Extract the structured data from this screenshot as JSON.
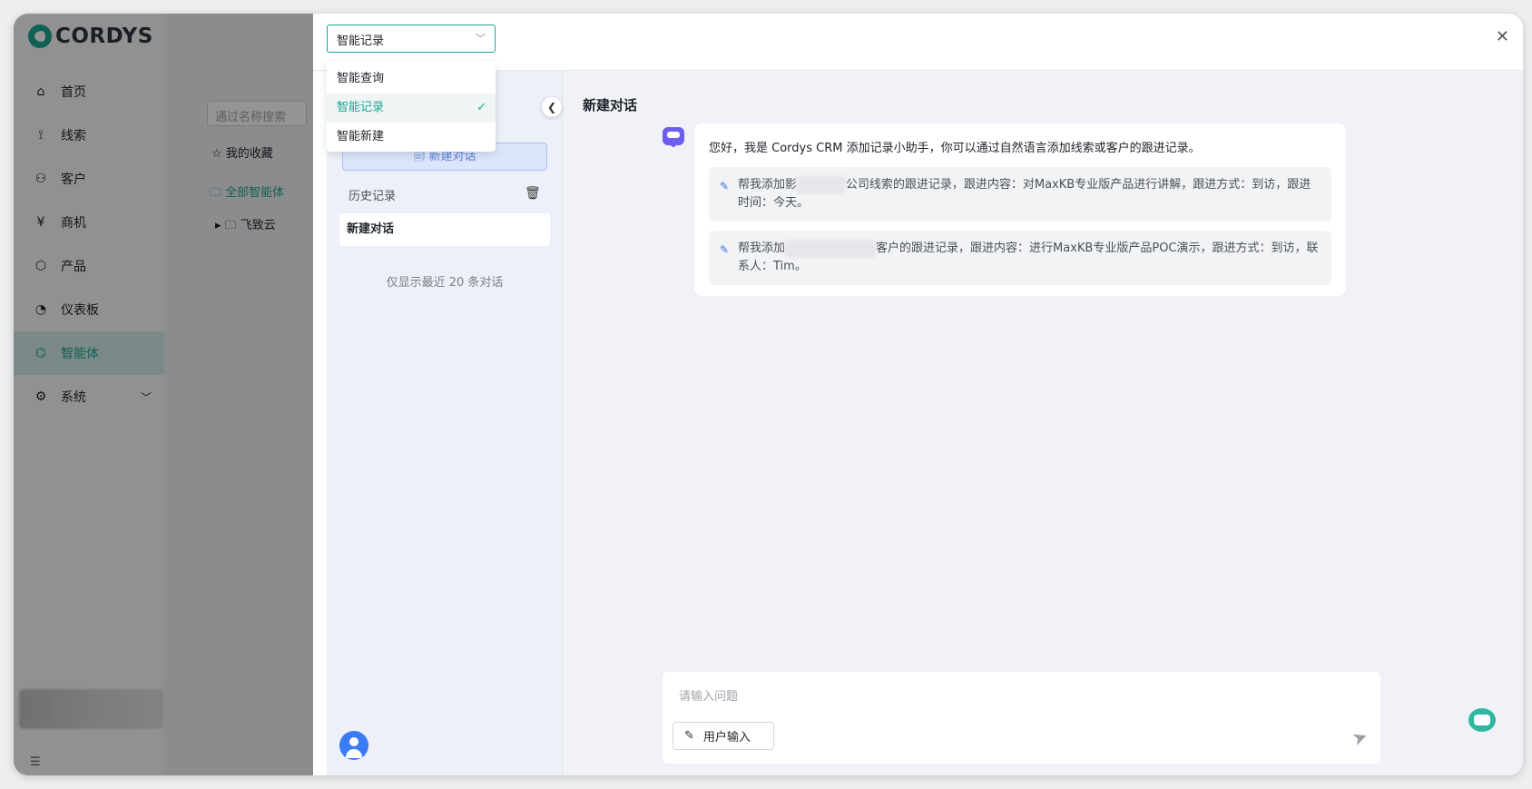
{
  "app": {
    "logo_text": "CORDYS"
  },
  "sidebar": {
    "items": [
      {
        "label": "首页",
        "icon": "⌂",
        "icon_name": "home-icon",
        "active": false
      },
      {
        "label": "线索",
        "icon": "⟟",
        "icon_name": "clue-icon",
        "active": false
      },
      {
        "label": "客户",
        "icon": "⚇",
        "icon_name": "customer-icon",
        "active": false
      },
      {
        "label": "商机",
        "icon": "¥",
        "icon_name": "opportunity-icon",
        "active": false
      },
      {
        "label": "产品",
        "icon": "⬡",
        "icon_name": "product-icon",
        "active": false
      },
      {
        "label": "仪表板",
        "icon": "◔",
        "icon_name": "dashboard-icon",
        "active": false
      },
      {
        "label": "智能体",
        "icon": "⌬",
        "icon_name": "robot-icon",
        "active": true
      },
      {
        "label": "系统",
        "icon": "⚙",
        "icon_name": "gear-icon",
        "active": false,
        "has_children": true
      }
    ]
  },
  "bg_content": {
    "search_placeholder": "通过名称搜索",
    "favorites": "☆ 我的收藏",
    "all_agents": "🗀 全部智能体",
    "folder": "▸  🗀 飞致云"
  },
  "drawer": {
    "select": {
      "value": "智能记录",
      "options": [
        "智能查询",
        "智能记录",
        "智能新建"
      ],
      "selected_index": 1
    },
    "new_chat_button": "🗐 新建对话",
    "history_label": "历史记录",
    "sessions": [
      "新建对话"
    ],
    "history_note": "仅显示最近 20 条对话",
    "chat_title": "新建对话",
    "greeting": "您好，我是 Cordys CRM 添加记录小助手，你可以通过自然语言添加线索或客户的跟进记录。",
    "suggestions": [
      {
        "prefix": "帮我添加影",
        "suffix": "公司线索的跟进记录，跟进内容：对MaxKB专业版产品进行讲解，跟进方式：到访，跟进时间：今天。"
      },
      {
        "prefix": "帮我添加",
        "suffix": "客户的跟进记录，跟进内容：进行MaxKB专业版产品POC演示，跟进方式：到访，联系人：Tim。"
      }
    ],
    "input_placeholder": "请输入问题",
    "user_input_button": "用户输入"
  },
  "colors": {
    "accent": "#1aa693",
    "primary_blue": "#3b7cf4",
    "bot_purple": "#6e5ef0"
  }
}
